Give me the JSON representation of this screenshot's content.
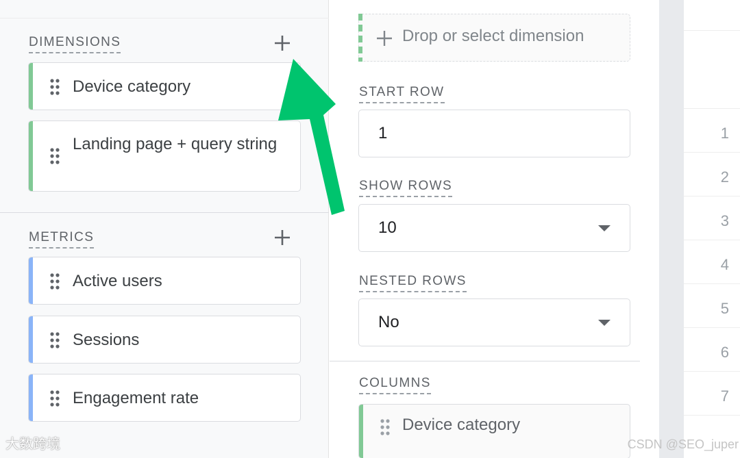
{
  "dimensions": {
    "title": "DIMENSIONS",
    "items": [
      {
        "label": "Device category"
      },
      {
        "label": "Landing page + query string"
      }
    ]
  },
  "metrics": {
    "title": "METRICS",
    "items": [
      {
        "label": "Active users"
      },
      {
        "label": "Sessions"
      },
      {
        "label": "Engagement rate"
      }
    ]
  },
  "rows_panel": {
    "drop_placeholder": "Drop or select dimension",
    "start_row": {
      "label": "START ROW",
      "value": "1"
    },
    "show_rows": {
      "label": "SHOW ROWS",
      "value": "10"
    },
    "nested_rows": {
      "label": "NESTED ROWS",
      "value": "No"
    }
  },
  "columns": {
    "title": "COLUMNS",
    "items": [
      {
        "label": "Device category"
      }
    ]
  },
  "table_row_numbers": [
    "1",
    "2",
    "3",
    "4",
    "5",
    "6",
    "7"
  ],
  "watermark": {
    "left": "大数跨境",
    "right": "CSDN @SEO_juper"
  },
  "colors": {
    "dimension_accent": "#81c995",
    "metric_accent": "#8ab4f8",
    "annotation_arrow": "#00c46e"
  },
  "icons": [
    "plus-icon",
    "drag-handle-icon",
    "dropdown-caret-icon",
    "arrow-annotation"
  ]
}
